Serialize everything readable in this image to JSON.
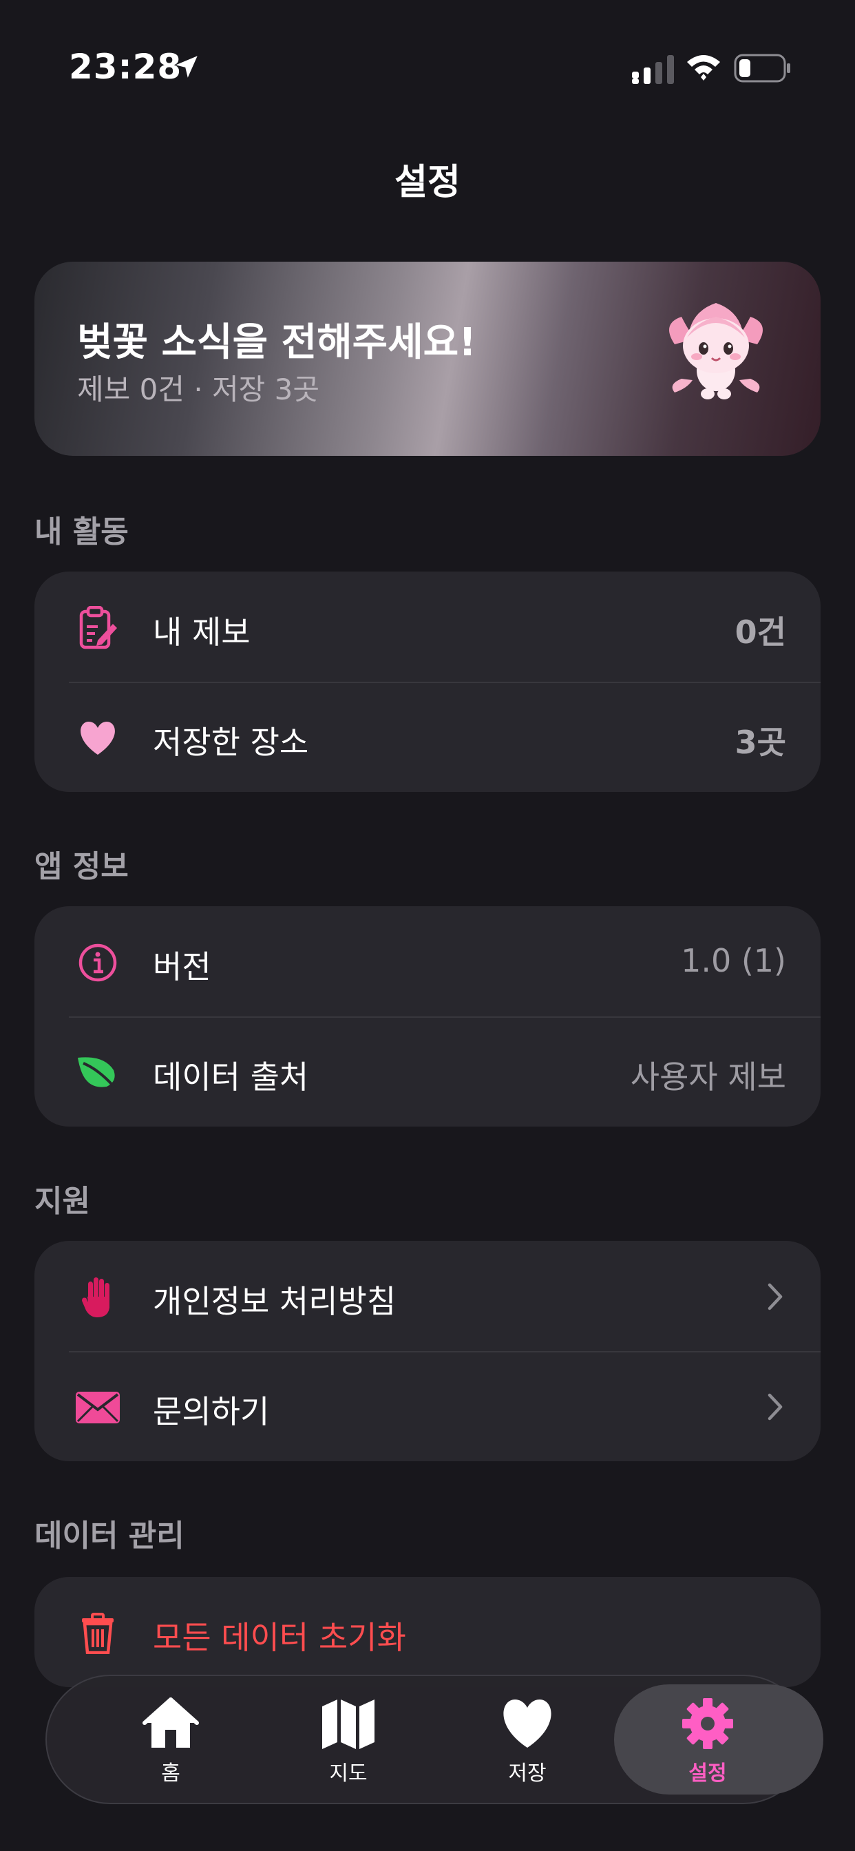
{
  "status_bar": {
    "time": "23:28"
  },
  "header": {
    "title": "설정"
  },
  "banner": {
    "title": "벚꽃 소식을 전해주세요!",
    "subtitle": "제보 0건 · 저장 3곳"
  },
  "sections": {
    "activity": {
      "label": "내 활동",
      "rows": [
        {
          "label": "내 제보",
          "value": "0건",
          "icon": "clipboard-edit-icon"
        },
        {
          "label": "저장한 장소",
          "value": "3곳",
          "icon": "heart-icon"
        }
      ]
    },
    "app_info": {
      "label": "앱 정보",
      "rows": [
        {
          "label": "버전",
          "value": "1.0 (1)",
          "icon": "info-icon"
        },
        {
          "label": "데이터 출처",
          "value": "사용자 제보",
          "icon": "leaf-icon"
        }
      ]
    },
    "support": {
      "label": "지원",
      "rows": [
        {
          "label": "개인정보 처리방침",
          "icon": "raised-hand-icon"
        },
        {
          "label": "문의하기",
          "icon": "envelope-icon"
        }
      ]
    },
    "data_management": {
      "label": "데이터 관리",
      "rows": [
        {
          "label": "모든 데이터 초기화",
          "icon": "trash-icon"
        }
      ]
    }
  },
  "tabbar": {
    "tabs": [
      {
        "label": "홈",
        "icon": "house-icon"
      },
      {
        "label": "지도",
        "icon": "map-icon"
      },
      {
        "label": "저장",
        "icon": "heart-icon"
      },
      {
        "label": "설정",
        "icon": "gear-icon",
        "active": true
      }
    ]
  },
  "colors": {
    "accent": "#ff5ec4",
    "danger": "#ff4d4f",
    "background": "#18171c",
    "card": "#28272d"
  }
}
